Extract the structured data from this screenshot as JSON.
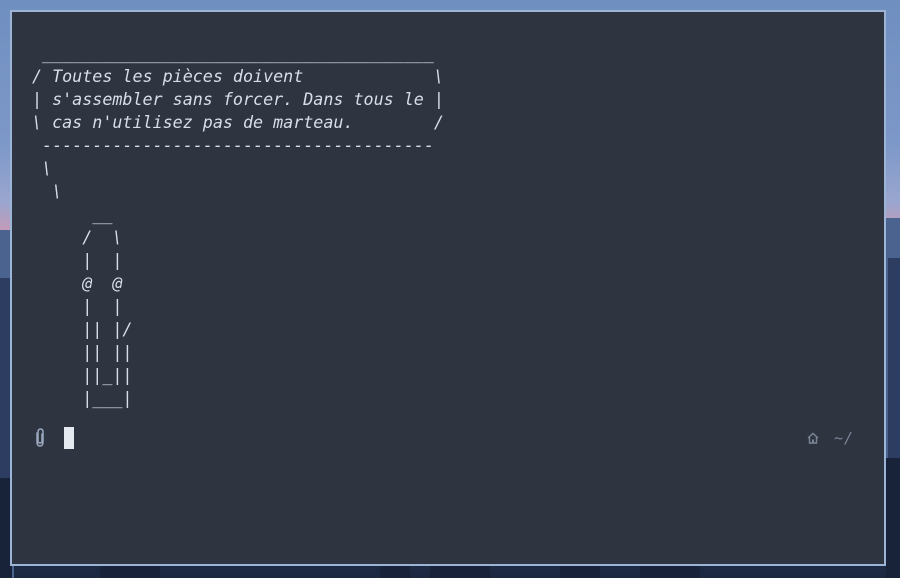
{
  "terminal": {
    "output_lines": [
      " _______________________________________",
      "/ Toutes les pièces doivent             \\",
      "| s'assembler sans forcer. Dans tous le |",
      "\\ cas n'utilisez pas de marteau.        /",
      " ---------------------------------------",
      " \\",
      "  \\",
      "      __",
      "     /  \\",
      "     |  |",
      "     @  @",
      "     |  |",
      "     || |/",
      "     || ||",
      "     ||_||",
      "     |___|"
    ],
    "prompt": {
      "left_icon": "paperclip-icon",
      "right_icon": "home-icon",
      "cwd": "~/"
    }
  },
  "colors": {
    "terminal_bg": "#2e3440",
    "foreground": "#d8dee9",
    "border": "#9cb4d6",
    "muted": "#7b8699"
  }
}
